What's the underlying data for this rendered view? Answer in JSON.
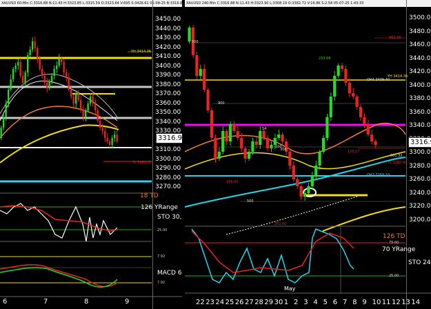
{
  "left_chart": {
    "header": "XAUUSD 60-Min  C:3316.88 N:11.43 H:3323.85 L:3315.59 O:3323.64 V:695 S:3426.61 05-08-25 B:3316.88 O:3308.59 S:3317.18 V:3,648",
    "last_price": "3316.92",
    "price_ticks": [
      "3450.00",
      "3440.00",
      "3430.00",
      "3420.00",
      "3410.00",
      "3400.00",
      "3390.00",
      "3380.00",
      "3370.00",
      "3360.00",
      "3350.00",
      "3340.00",
      "3330.00",
      "3320.00",
      "3310.00",
      "3300.00",
      "3290.00",
      "3280.00",
      "3270.00"
    ],
    "x_ticks": [
      "6",
      "7",
      "8",
      "9"
    ],
    "annotations": {
      "yh": "YH 3414.36",
      "yl": "YL 3280.00",
      "td": "18 TD",
      "yrange": "126 YRange",
      "sto": "STO  30,",
      "macd": "MACD 6,",
      "osc_level_1": "25.00",
      "osc_level_2": "7.92",
      "osc_level_3": "7.92"
    },
    "colors": {
      "up": "#22dd22",
      "down": "#ee2222",
      "yellow": "#f5e000",
      "cyan": "#22d7ee",
      "magenta": "#ff00ff",
      "grey": "#c8c8c8"
    }
  },
  "right_chart": {
    "header": "XAUUSD 240-Min  C:3316.88 N:11.43 H:3323.90 L:3308.19 O:3382.72 V:16.8K S:2.58 05-07-25 1:43:33",
    "last_price": "3316.92",
    "price_ticks": [
      "3500.00",
      "3480.00",
      "3460.00",
      "3440.00",
      "3420.00",
      "3400.00",
      "3380.00",
      "3360.00",
      "3340.00",
      "3320.00",
      "3300.00",
      "3280.00",
      "3260.00",
      "3240.00",
      "3220.00",
      "3200.00"
    ],
    "x_ticks": [
      "22",
      "23",
      "24",
      "25",
      "26",
      "27",
      "28",
      "29",
      "30",
      "1",
      "2",
      "3",
      "4",
      "5",
      "6",
      "7",
      "8",
      "9",
      "10",
      "11",
      "12",
      "13",
      "14"
    ],
    "month_label": "May",
    "annotations": {
      "top_red": "962.36",
      "yh": "YH 3414.36",
      "oh": "OH4 3409.40",
      "high_mark": "233.06",
      "mid_500": "500",
      "mid_900": "900",
      "q54": "54",
      "mark_236": "236.00",
      "mark_300": "300",
      "mark_500b": "500",
      "mark_100": "100",
      "r1": "126.27",
      "r2": "001.32",
      "yl": "YL 3280.00",
      "oh3": "OH3 3269.33",
      "bottom": "201.00",
      "td": "126 TD",
      "yrange": "70 YRange",
      "sto": "STO  24",
      "osc_75": "75.00",
      "osc_25": "25.00"
    }
  }
}
